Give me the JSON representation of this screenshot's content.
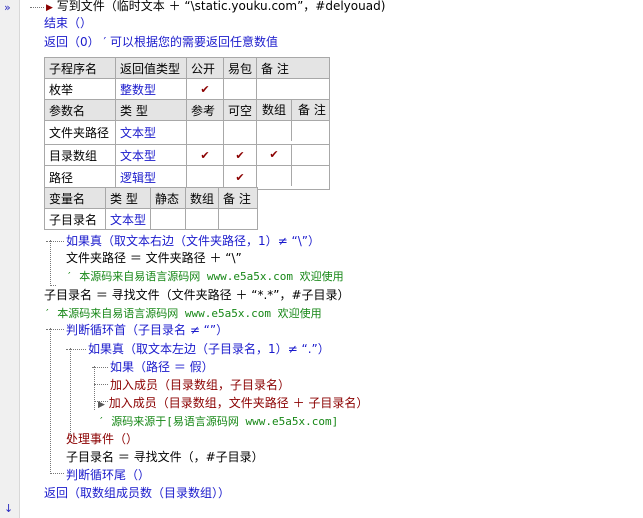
{
  "lines": {
    "l0": "写到文件（临时文本 ＋ “\\static.youku.com”，#delyouad)",
    "l1": "结束（）",
    "l2": "返回（0） ′ 可以根据您的需要返回任意数值",
    "if1": "如果真（取文本右边（文件夹路径，1）≠ “\\”）",
    "a1": "文件夹路径 ＝ 文件夹路径 ＋ “\\”",
    "c1": "′ 本源码来自易语言源码网 www.e5a5x.com  欢迎使用",
    "a2": "子目录名 ＝ 寻找文件（文件夹路径 ＋ “*.*”，#子目录）",
    "c2": "′ 本源码来自易语言源码网 www.e5a5x.com  欢迎使用",
    "loop": "判断循环首（子目录名 ≠ “”）",
    "if2": "如果真（取文本左边（子目录名，1）≠ “.”）",
    "if3": "如果（路径 ＝ 假）",
    "add1": "加入成员（目录数组，子目录名）",
    "add2": "加入成员（目录数组，文件夹路径 ＋ 子目录名）",
    "c3": "′ 源码来源于[易语言源码网 www.e5a5x.com]",
    "ev": "处理事件（）",
    "a3": "子目录名 ＝ 寻找文件（，#子目录）",
    "loopend": "判断循环尾（）",
    "ret": "返回（取数组成员数（目录数组））"
  },
  "sub": {
    "headers": [
      "子程序名",
      "返回值类型",
      "公开",
      "易包",
      "备 注"
    ],
    "name": "枚举",
    "ret_type": "整数型",
    "public_check": "✔"
  },
  "params": {
    "headers": [
      "参数名",
      "类 型",
      "参考",
      "可空",
      "数组",
      "备 注"
    ],
    "rows": [
      {
        "name": "文件夹路径",
        "type": "文本型",
        "ref": "",
        "opt": "",
        "arr": ""
      },
      {
        "name": "目录数组",
        "type": "文本型",
        "ref": "✔",
        "opt": "✔",
        "arr": "✔"
      },
      {
        "name": "路径",
        "type": "逻辑型",
        "ref": "",
        "opt": "✔",
        "arr": ""
      }
    ]
  },
  "vars": {
    "headers": [
      "变量名",
      "类 型",
      "静态",
      "数组",
      "备 注"
    ],
    "name": "子目录名",
    "type": "文本型"
  },
  "colors": {
    "keyword": "#1a1acc",
    "comment": "#168716",
    "check": "#8b0000",
    "header_bg": "#e4e4e4"
  }
}
